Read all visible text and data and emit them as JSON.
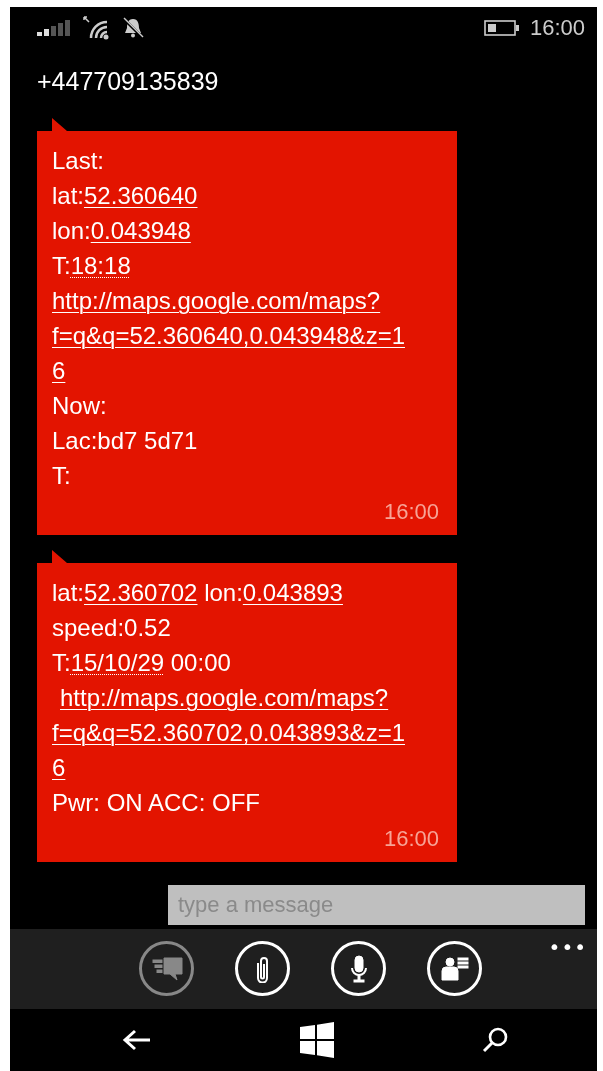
{
  "status_bar": {
    "time": "16:00"
  },
  "contact": {
    "title": "+447709135839"
  },
  "messages": [
    {
      "time": "16:00",
      "lines": [
        {
          "indent": false,
          "parts": [
            {
              "text": "Last:",
              "kind": "text"
            }
          ]
        },
        {
          "indent": false,
          "parts": [
            {
              "text": "lat:",
              "kind": "text"
            },
            {
              "text": "52.360640",
              "kind": "link"
            }
          ]
        },
        {
          "indent": false,
          "parts": [
            {
              "text": "lon:",
              "kind": "text"
            },
            {
              "text": "0.043948",
              "kind": "link"
            }
          ]
        },
        {
          "indent": false,
          "parts": [
            {
              "text": "T:",
              "kind": "text"
            },
            {
              "text": "18:18",
              "kind": "date"
            }
          ]
        },
        {
          "indent": false,
          "parts": [
            {
              "text": "http://maps.google.com/maps?",
              "kind": "link"
            }
          ]
        },
        {
          "indent": false,
          "parts": [
            {
              "text": "f=q&q=52.360640,0.043948&z=1",
              "kind": "link"
            }
          ]
        },
        {
          "indent": false,
          "parts": [
            {
              "text": "6",
              "kind": "link"
            }
          ]
        },
        {
          "indent": false,
          "parts": [
            {
              "text": "Now:",
              "kind": "text"
            }
          ]
        },
        {
          "indent": false,
          "parts": [
            {
              "text": "Lac:bd7 5d71",
              "kind": "text"
            }
          ]
        },
        {
          "indent": false,
          "parts": [
            {
              "text": "T:",
              "kind": "text"
            }
          ]
        }
      ]
    },
    {
      "time": "16:00",
      "lines": [
        {
          "indent": false,
          "parts": [
            {
              "text": "lat:",
              "kind": "text"
            },
            {
              "text": "52.360702",
              "kind": "link"
            },
            {
              "text": " lon:",
              "kind": "text"
            },
            {
              "text": "0.043893",
              "kind": "link"
            }
          ]
        },
        {
          "indent": false,
          "parts": [
            {
              "text": "speed:0.52",
              "kind": "text"
            }
          ]
        },
        {
          "indent": false,
          "parts": [
            {
              "text": "T:",
              "kind": "text"
            },
            {
              "text": "15/10/29",
              "kind": "date"
            },
            {
              "text": " 00:00",
              "kind": "text"
            }
          ]
        },
        {
          "indent": true,
          "parts": [
            {
              "text": "http://maps.google.com/maps?",
              "kind": "link"
            }
          ]
        },
        {
          "indent": false,
          "parts": [
            {
              "text": "f=q&q=52.360702,0.043893&z=1",
              "kind": "link"
            }
          ]
        },
        {
          "indent": false,
          "parts": [
            {
              "text": "6",
              "kind": "link"
            }
          ]
        },
        {
          "indent": false,
          "parts": [
            {
              "text": "Pwr: ON ACC: OFF",
              "kind": "text"
            }
          ]
        }
      ]
    }
  ],
  "compose": {
    "placeholder": "type a message"
  },
  "app_bar": {
    "buttons": [
      {
        "kind": "switch",
        "disabled": true
      },
      {
        "kind": "attach",
        "disabled": false
      },
      {
        "kind": "voice",
        "disabled": false
      },
      {
        "kind": "contact",
        "disabled": false
      }
    ],
    "more": "•••"
  }
}
